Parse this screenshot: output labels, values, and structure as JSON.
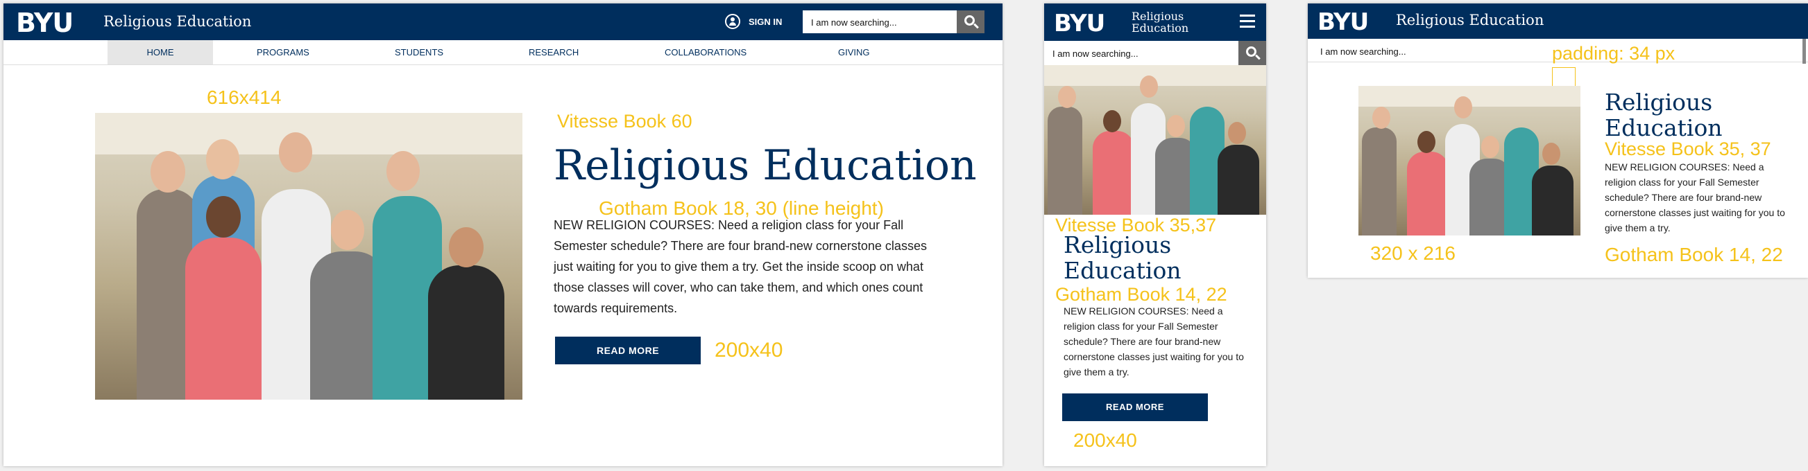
{
  "colors": {
    "navy": "#002e5d",
    "annotation": "#f5c21b",
    "grey_button": "#666666",
    "active_nav": "#e6e6e6"
  },
  "brand": {
    "logo": "BYU",
    "department": "Religious Education",
    "department_line1": "Religious",
    "department_line2": "Education"
  },
  "desktop": {
    "sign_in": "SIGN IN",
    "search_value": "I am now searching...",
    "nav": [
      "HOME",
      "PROGRAMS",
      "STUDENTS",
      "RESEARCH",
      "COLLABORATIONS",
      "GIVING"
    ],
    "title": "Religious Education",
    "body": "NEW RELIGION COURSES: Need a religion class for your Fall Semester schedule? There are four brand-new cornerstone classes just waiting for you to give them a try. Get the inside scoop on what those classes will cover, who can take them, and which ones count towards requirements.",
    "button": "READ MORE",
    "annotations": {
      "image": "616x414",
      "title_font": "Vitesse Book 60",
      "body_font": "Gotham Book 18, 30 (line height)",
      "button_size": "200x40"
    }
  },
  "mobile": {
    "search_value": "I am now searching...",
    "title_line1": "Religious",
    "title_line2": "Education",
    "body": "NEW RELIGION COURSES: Need a religion class for your Fall Semester schedule? There are four brand-new cornerstone classes just waiting for you to give them a try.",
    "button": "READ MORE",
    "annotations": {
      "title_font": "Vitesse Book 35,37",
      "body_font": "Gotham Book 14, 22",
      "button_size": "200x40"
    }
  },
  "tablet": {
    "search_value": "I am now searching...",
    "title_line1": "Religious",
    "title_line2": "Education",
    "body": "NEW RELIGION COURSES: Need a religion class for your Fall Semester schedule? There are four brand-new cornerstone classes just waiting for you to give them a try.",
    "annotations": {
      "padding": "padding: 34 px",
      "title_font": "Vitesse Book 35, 37",
      "image": "320 x 216",
      "body_font": "Gotham Book 14, 22"
    }
  }
}
